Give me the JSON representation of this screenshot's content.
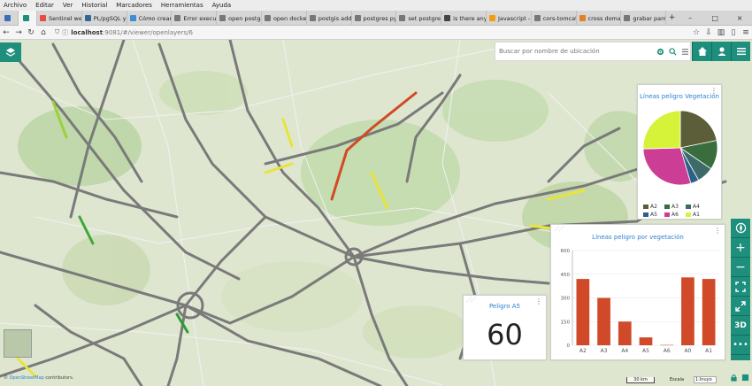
{
  "browser": {
    "menu": [
      "Archivo",
      "Editar",
      "Ver",
      "Historial",
      "Marcadores",
      "Herramientas",
      "Ayuda"
    ],
    "tabs": [
      {
        "label": "Sentinel we",
        "color": "#e74c3c"
      },
      {
        "label": "PL/pgSQL y",
        "color": "#336791"
      },
      {
        "label": "Cómo crear",
        "color": "#3a8fd9"
      },
      {
        "label": "Error execut",
        "color": "#777777"
      },
      {
        "label": "open postgr",
        "color": "#777777"
      },
      {
        "label": "open docker",
        "color": "#777777"
      },
      {
        "label": "postgis add",
        "color": "#777777"
      },
      {
        "label": "postgres pyt",
        "color": "#777777"
      },
      {
        "label": "set postgres",
        "color": "#777777"
      },
      {
        "label": "is there any",
        "color": "#444444"
      },
      {
        "label": "Javascript -",
        "color": "#f39c12"
      },
      {
        "label": "cors-tomcat",
        "color": "#777777"
      },
      {
        "label": "cross domai",
        "color": "#e67e22"
      },
      {
        "label": "grabar pant",
        "color": "#777777"
      }
    ],
    "url_host": "localhost",
    "url_rest": ":9081/#/viewer/openlayers/6"
  },
  "search": {
    "placeholder": "Buscar por nombre de ubicación"
  },
  "pie_widget": {
    "title": "Líneas peligro Vegetación"
  },
  "bar_widget": {
    "title": "Líneas peligro por vegetación"
  },
  "kpi_widget": {
    "title": "Peligro A5",
    "value": "60"
  },
  "tools": {
    "three_d": "3D"
  },
  "attribution": {
    "link": "OpenStreetMap",
    "text": " contributors."
  },
  "scale": {
    "bar": "30 km",
    "label": "Escala",
    "value": "1:Inuyo"
  },
  "colors": {
    "accent": "#1e8f7c",
    "bar": "#d04a2a",
    "title": "#2b7fd1"
  },
  "chart_data": [
    {
      "type": "pie",
      "title": "Líneas peligro Vegetación",
      "categories": [
        "A2",
        "A3",
        "A4",
        "A5",
        "A6",
        "A1"
      ],
      "values": [
        120,
        70,
        40,
        20,
        160,
        140
      ],
      "colors": [
        "#5b5e38",
        "#3a6d3d",
        "#3e6b6a",
        "#2c5f8a",
        "#cc3d96",
        "#d6f33a"
      ]
    },
    {
      "type": "bar",
      "title": "Líneas peligro por vegetación",
      "categories": [
        "A2",
        "A3",
        "A4",
        "A5",
        "A6",
        "A0",
        "A1"
      ],
      "values": [
        420,
        300,
        150,
        50,
        2,
        430,
        420
      ],
      "ylim": [
        0,
        600
      ],
      "yticks": [
        0,
        150,
        300,
        450,
        600
      ]
    }
  ]
}
